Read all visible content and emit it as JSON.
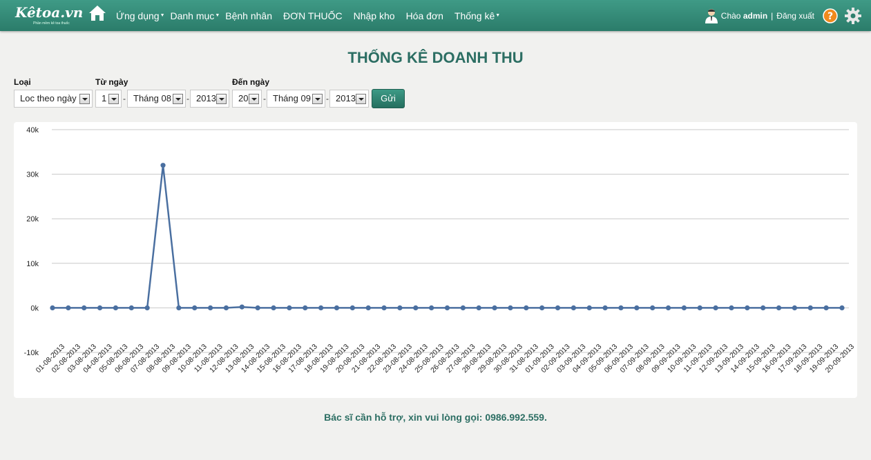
{
  "brand": {
    "logo_text": "Kêtoa.vn",
    "tagline": "Phần mềm kê toa thuốc"
  },
  "nav": {
    "items": [
      {
        "label": "Ứng dụng",
        "dropdown": true
      },
      {
        "label": "Danh mục",
        "dropdown": true
      },
      {
        "label": "Bệnh nhân",
        "dropdown": false
      },
      {
        "label": "ĐƠN THUỐC",
        "dropdown": false
      },
      {
        "label": "Nhập kho",
        "dropdown": false
      },
      {
        "label": "Hóa đơn",
        "dropdown": false
      },
      {
        "label": "Thống kê",
        "dropdown": true
      }
    ]
  },
  "user": {
    "greeting": "Chào",
    "name": "admin",
    "separator": "|",
    "logout": "Đăng xuất"
  },
  "page": {
    "title": "THỐNG KÊ DOANH THU"
  },
  "filter": {
    "type_label": "Loại",
    "type_value": "Loc theo ngày",
    "from_label": "Từ ngày",
    "from_day": "1",
    "from_month": "Tháng 08",
    "from_year": "2013",
    "to_label": "Đến ngày",
    "to_day": "20",
    "to_month": "Tháng 09",
    "to_year": "2013",
    "dash": "-",
    "submit": "Gửi"
  },
  "chart_data": {
    "type": "line",
    "title": "",
    "xlabel": "",
    "ylabel": "",
    "ylim": [
      -10000,
      40000
    ],
    "yticks": [
      -10000,
      0,
      10000,
      20000,
      30000,
      40000
    ],
    "ytick_labels": [
      "-10k",
      "0k",
      "10k",
      "20k",
      "30k",
      "40k"
    ],
    "grid": true,
    "legend": "none",
    "line_color": "#4a6fa0",
    "categories": [
      "01-08-2013",
      "02-08-2013",
      "03-08-2013",
      "04-08-2013",
      "05-08-2013",
      "06-08-2013",
      "07-08-2013",
      "08-08-2013",
      "09-08-2013",
      "10-08-2013",
      "11-08-2013",
      "12-08-2013",
      "13-08-2013",
      "14-08-2013",
      "15-08-2013",
      "16-08-2013",
      "17-08-2013",
      "18-08-2013",
      "19-08-2013",
      "20-08-2013",
      "21-08-2013",
      "22-08-2013",
      "23-08-2013",
      "24-08-2013",
      "25-08-2013",
      "26-08-2013",
      "27-08-2013",
      "28-08-2013",
      "29-08-2013",
      "30-08-2013",
      "31-08-2013",
      "01-09-2013",
      "02-09-2013",
      "03-09-2013",
      "04-09-2013",
      "05-09-2013",
      "06-09-2013",
      "07-09-2013",
      "08-09-2013",
      "09-09-2013",
      "10-09-2013",
      "11-09-2013",
      "12-09-2013",
      "13-09-2013",
      "14-09-2013",
      "15-09-2013",
      "16-09-2013",
      "17-09-2013",
      "18-09-2013",
      "19-09-2013",
      "20-09-2013"
    ],
    "values": [
      0,
      0,
      0,
      0,
      0,
      0,
      0,
      32000,
      0,
      0,
      0,
      0,
      200,
      0,
      0,
      0,
      0,
      0,
      0,
      0,
      0,
      0,
      0,
      0,
      0,
      0,
      0,
      0,
      0,
      0,
      0,
      0,
      0,
      0,
      0,
      0,
      0,
      0,
      0,
      0,
      0,
      0,
      0,
      0,
      0,
      0,
      0,
      0,
      0,
      0,
      0
    ]
  },
  "footer": {
    "text": "Bác sĩ cần hỗ trợ, xin vui lòng gọi: 0986.992.559."
  },
  "colors": {
    "primary": "#2c7a68",
    "title": "#2c6e63"
  }
}
